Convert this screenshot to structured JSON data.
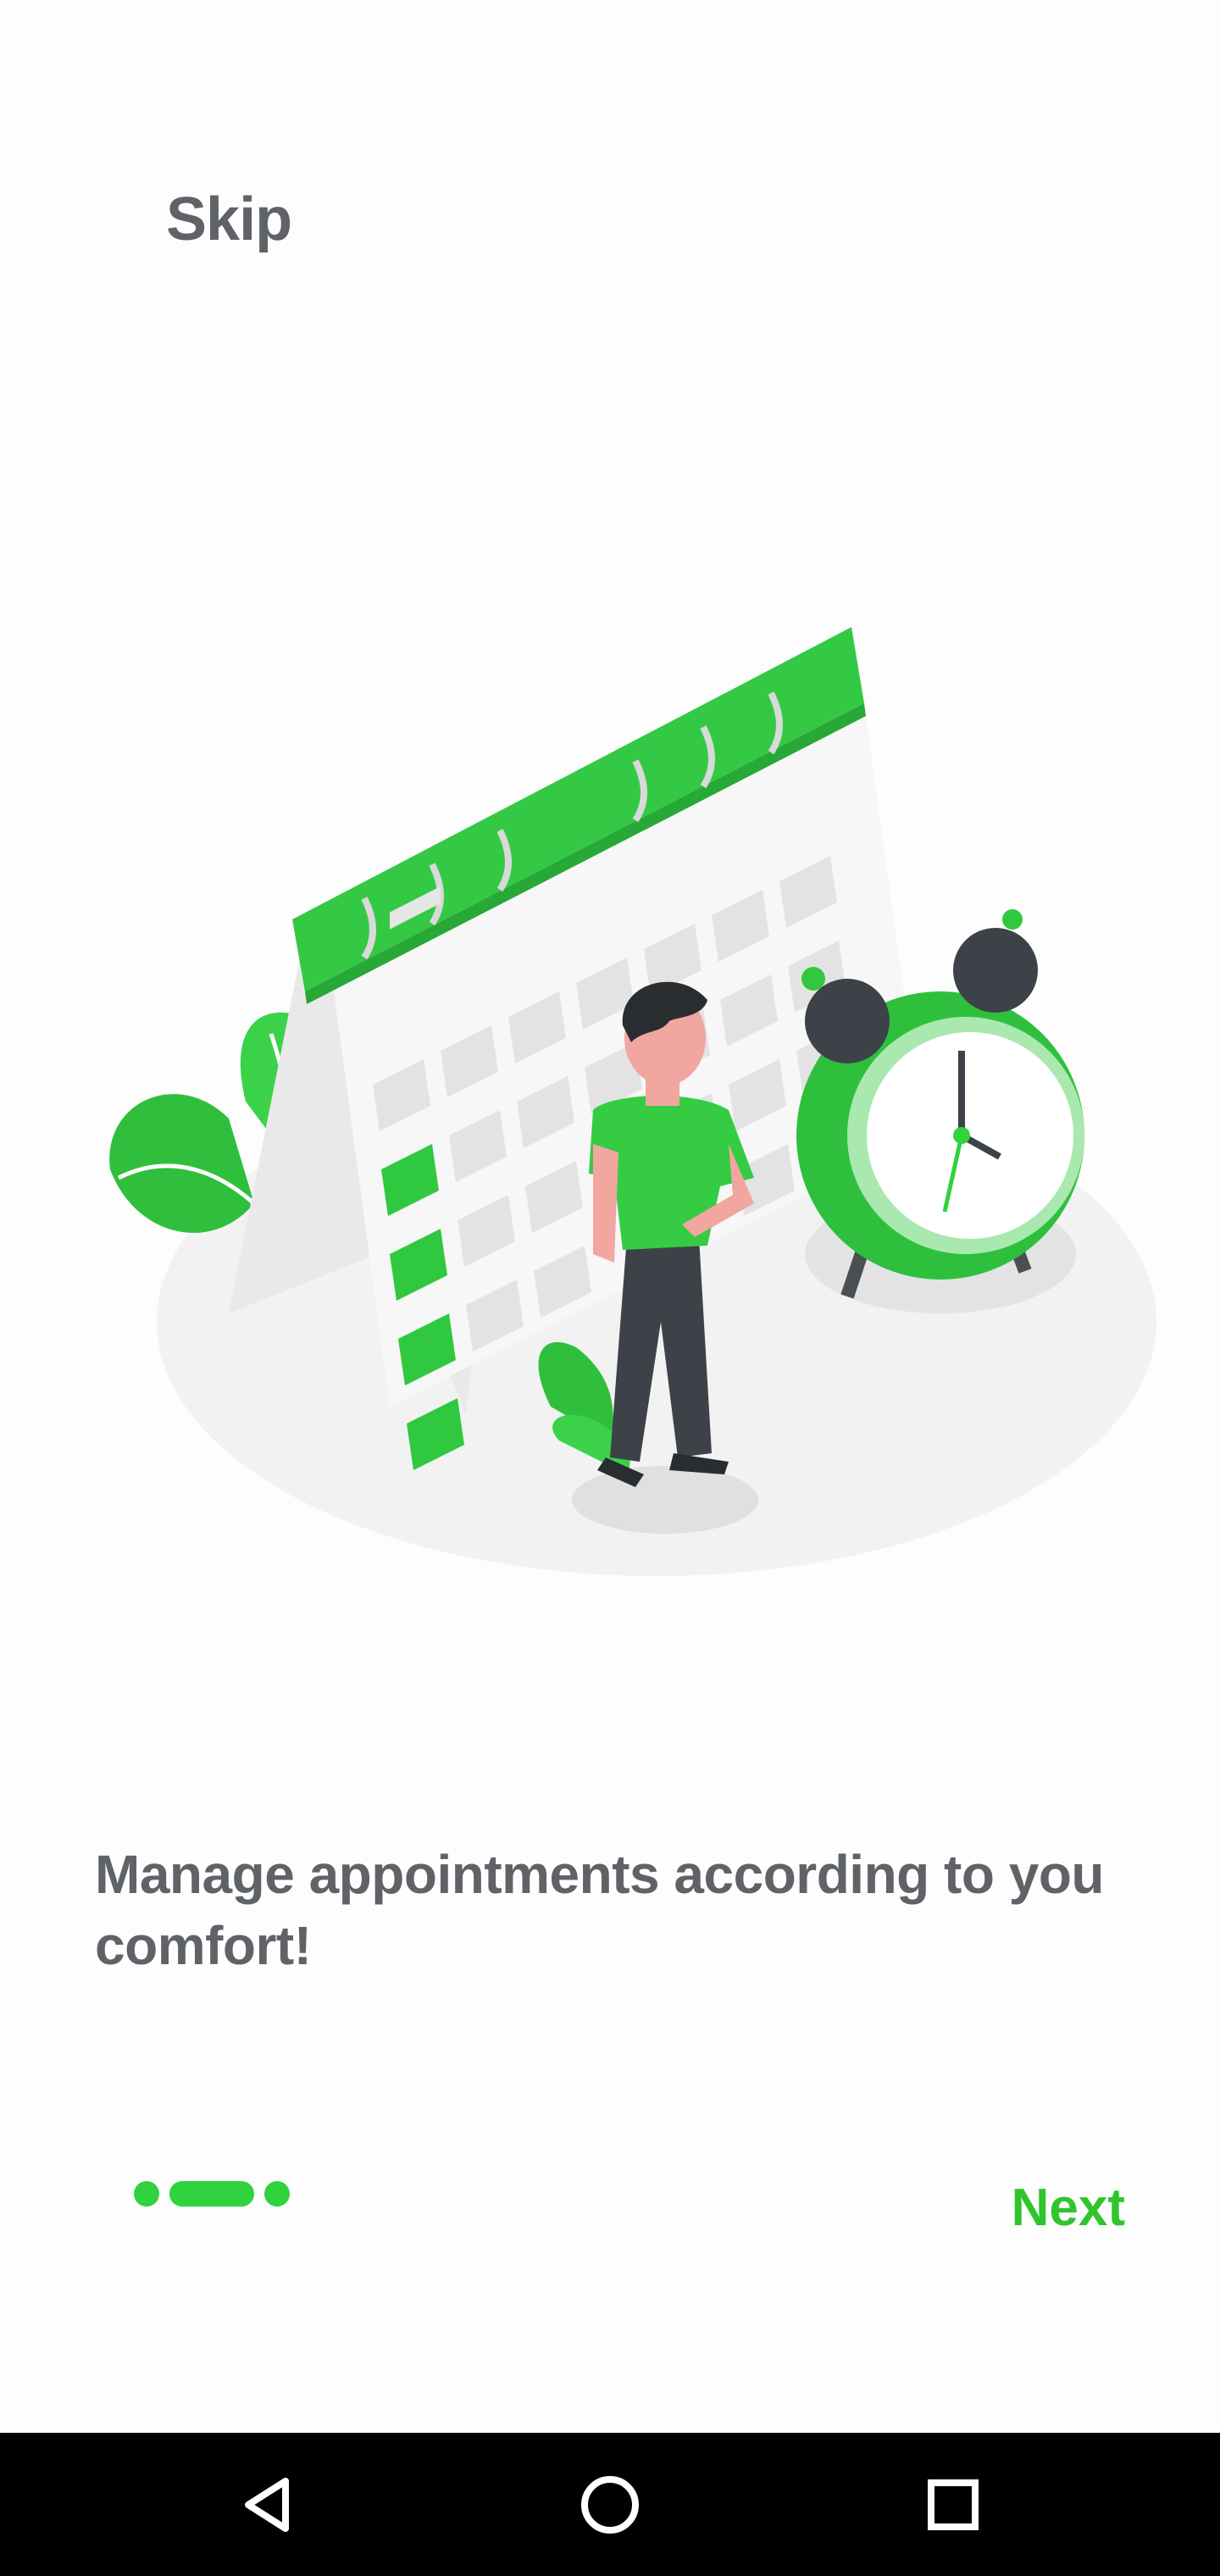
{
  "header": {
    "skip_label": "Skip"
  },
  "onboarding": {
    "headline": "Manage appointments according to you comfort!",
    "page_indicator": {
      "total": 3,
      "active_index": 1
    },
    "next_label": "Next"
  },
  "colors": {
    "accent_green": "#30d23e",
    "text_gray": "#5f6368",
    "nav_bar": "#000000"
  },
  "icons": {
    "illustration": "calendar-person-clock-illustration",
    "nav_back": "back-triangle-icon",
    "nav_home": "home-circle-icon",
    "nav_recent": "recent-square-icon"
  }
}
